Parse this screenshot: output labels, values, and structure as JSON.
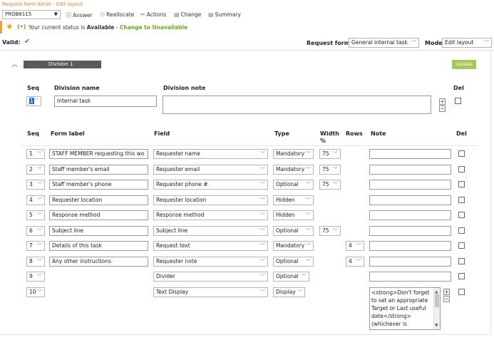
{
  "header": {
    "title": "Request form detail - Edit layout",
    "form_id": "PROB8115",
    "colors": {
      "title": "#d9822b",
      "green": "#6aa61e",
      "division_bar": "#5a5a5a",
      "update": "#a6c85a"
    }
  },
  "toolbar": {
    "answer": "Answer",
    "reallocate": "Reallocate",
    "actions": "Actions",
    "change": "Change",
    "summary": "Summary"
  },
  "status": {
    "prefix": "Your current status is",
    "value": "Available",
    "dash": "-",
    "link": "Change to Unavailable"
  },
  "valid_label": "Valid:",
  "request_form": {
    "label": "Request form",
    "value": "General internal task"
  },
  "mode": {
    "label": "Mode",
    "value": "Edit layout"
  },
  "division": {
    "bar_label": "Division 1",
    "update_button": "Update",
    "headers": {
      "seq": "Seq",
      "name": "Division name",
      "note": "Division note",
      "del": "Del"
    },
    "seq": "1",
    "name": "Internal task",
    "note": ""
  },
  "fields_table": {
    "headers": {
      "seq": "Seq",
      "label": "Form label",
      "field": "Field",
      "type": "Type",
      "width": "Width %",
      "rows": "Rows",
      "note": "Note",
      "del": "Del"
    },
    "rows": [
      {
        "seq": "1",
        "label": "STAFF MEMBER requesting this wo",
        "field": "Requester name",
        "type": "Mandatory",
        "width": "75",
        "rows": "",
        "note": ""
      },
      {
        "seq": "2",
        "label": "Staff member's email",
        "field": "Requester email",
        "type": "Mandatory",
        "width": "75",
        "rows": "",
        "note": ""
      },
      {
        "seq": "3",
        "label": "Staff member's phone",
        "field": "Requester phone #",
        "type": "Optional",
        "width": "75",
        "rows": "",
        "note": ""
      },
      {
        "seq": "4",
        "label": "Requester location",
        "field": "Requester location",
        "type": "Hidden",
        "width": "",
        "rows": "",
        "note": ""
      },
      {
        "seq": "5",
        "label": "Response method",
        "field": "Response method",
        "type": "Hidden",
        "width": "",
        "rows": "",
        "note": ""
      },
      {
        "seq": "6",
        "label": "Subject line",
        "field": "Subject line",
        "type": "Optional",
        "width": "75",
        "rows": "",
        "note": ""
      },
      {
        "seq": "7",
        "label": "Details of this task",
        "field": "Request text",
        "type": "Mandatory",
        "width": "",
        "rows": "4",
        "note": ""
      },
      {
        "seq": "8",
        "label": "Any other instructions",
        "field": "Requester note",
        "type": "Optional",
        "width": "",
        "rows": "4",
        "note": ""
      },
      {
        "seq": "9",
        "label": "",
        "field": "Divider",
        "type": "Optional",
        "width": "",
        "rows": "",
        "note": ""
      },
      {
        "seq": "10",
        "label": "",
        "field": "Text Display",
        "type": "Display",
        "width": "",
        "rows": "",
        "note": "<strong>Don't forget to set an appropriate Target or Last useful date</strong> (whichever is"
      }
    ]
  }
}
